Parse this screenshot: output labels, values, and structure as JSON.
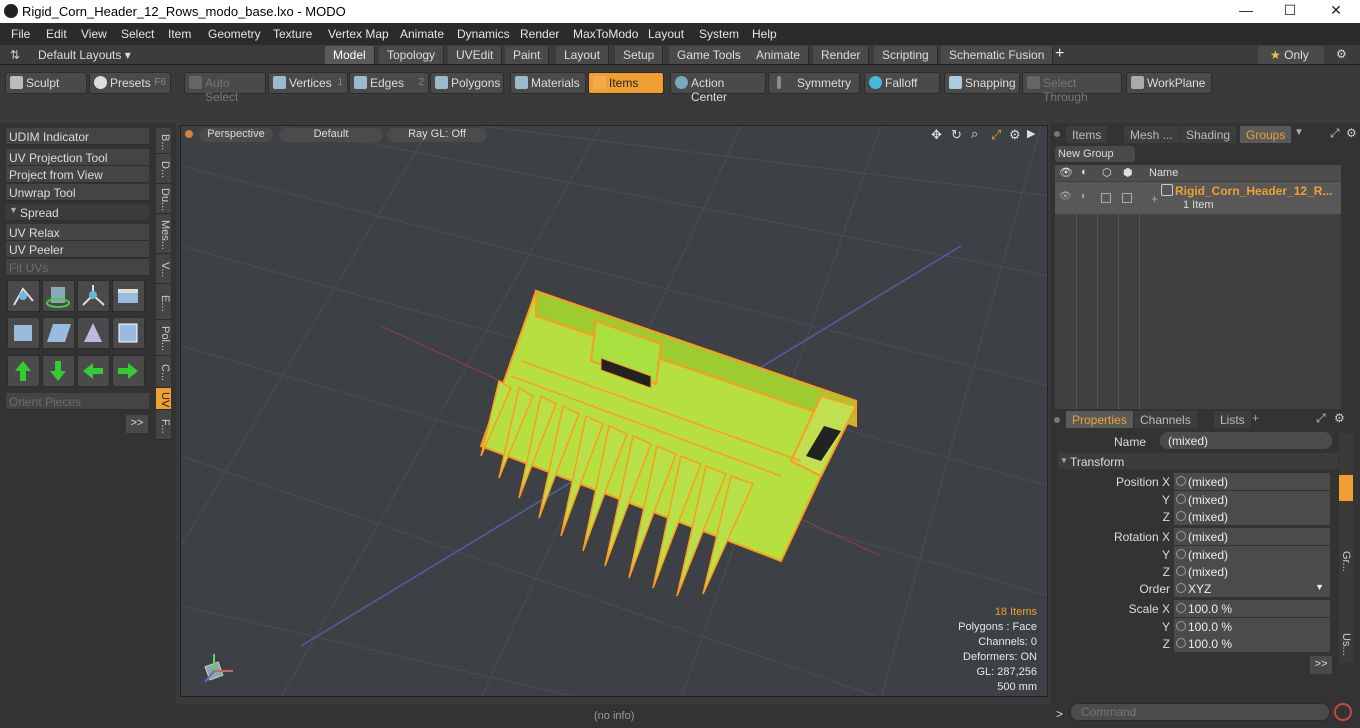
{
  "window": {
    "title": "Rigid_Corn_Header_12_Rows_modo_base.lxo - MODO",
    "minimize": "—",
    "maximize": "☐",
    "close": "✕"
  },
  "menu": [
    "File",
    "Edit",
    "View",
    "Select",
    "Item",
    "Geometry",
    "Texture",
    "Vertex Map",
    "Animate",
    "Dynamics",
    "Render",
    "MaxToModo",
    "Layout",
    "System",
    "Help"
  ],
  "layoutbar": {
    "layouts_label": "Default Layouts",
    "tabs": [
      "Model",
      "Topology",
      "UVEdit",
      "Paint",
      "Layout",
      "Setup",
      "Game Tools",
      "Animate",
      "Render",
      "Scripting",
      "Schematic Fusion"
    ],
    "active_tab": "Model",
    "add": "+",
    "only_label": "Only",
    "star": "★"
  },
  "toolbar": {
    "sculpt": "Sculpt",
    "presets": "Presets",
    "presets_key": "F6",
    "auto_select": "Auto Select",
    "vertices": "Vertices",
    "vertices_key": "1",
    "edges": "Edges",
    "edges_key": "2",
    "polygons": "Polygons",
    "materials": "Materials",
    "items": "Items",
    "action_center": "Action Center",
    "symmetry": "Symmetry",
    "falloff": "Falloff",
    "snapping": "Snapping",
    "select_through": "Select Through",
    "workplane": "WorkPlane"
  },
  "leftpanel": {
    "buttons": [
      "UDIM Indicator",
      "UV Projection Tool",
      "Project from View",
      "Unwrap Tool",
      "Spread",
      "UV Relax",
      "UV Peeler",
      "Fit UVs"
    ],
    "orient_pieces": "Orient Pieces",
    "more": ">>",
    "vtabs": [
      "B...",
      "D...",
      "Du...",
      "Mes...",
      "V...",
      "E...",
      "Pol...",
      "C...",
      "UV",
      "F..."
    ]
  },
  "viewport": {
    "perspective": "Perspective",
    "shading": "Default",
    "raygl": "Ray GL: Off",
    "info": {
      "items": "18 Items",
      "polygons": "Polygons : Face",
      "channels": "Channels: 0",
      "deformers": "Deformers: ON",
      "gl": "GL: 287,256",
      "scale": "500 mm"
    }
  },
  "status": {
    "info": "(no info)"
  },
  "groups": {
    "tabs": [
      "Items",
      "Mesh ...",
      "Shading",
      "Groups"
    ],
    "active": "Groups",
    "new_group": "New Group",
    "col_name": "Name",
    "item_name": "Rigid_Corn_Header_12_R...",
    "item_count": "1 Item"
  },
  "properties": {
    "tabs": [
      "Properties",
      "Channels",
      "Lists"
    ],
    "name_label": "Name",
    "name_value": "(mixed)",
    "transform": "Transform",
    "rows": [
      {
        "label": "Position X",
        "value": "(mixed)"
      },
      {
        "label": "Y",
        "value": "(mixed)"
      },
      {
        "label": "Z",
        "value": "(mixed)"
      },
      {
        "label": "Rotation X",
        "value": "(mixed)"
      },
      {
        "label": "Y",
        "value": "(mixed)"
      },
      {
        "label": "Z",
        "value": "(mixed)"
      },
      {
        "label": "Order",
        "value": "XYZ"
      },
      {
        "label": "Scale X",
        "value": "100.0 %"
      },
      {
        "label": "Y",
        "value": "100.0 %"
      },
      {
        "label": "Z",
        "value": "100.0 %"
      }
    ],
    "side_tabs": [
      "Gr...",
      "Us..."
    ],
    "more": ">>"
  },
  "command": {
    "placeholder": "Command",
    "prompt": ">"
  }
}
